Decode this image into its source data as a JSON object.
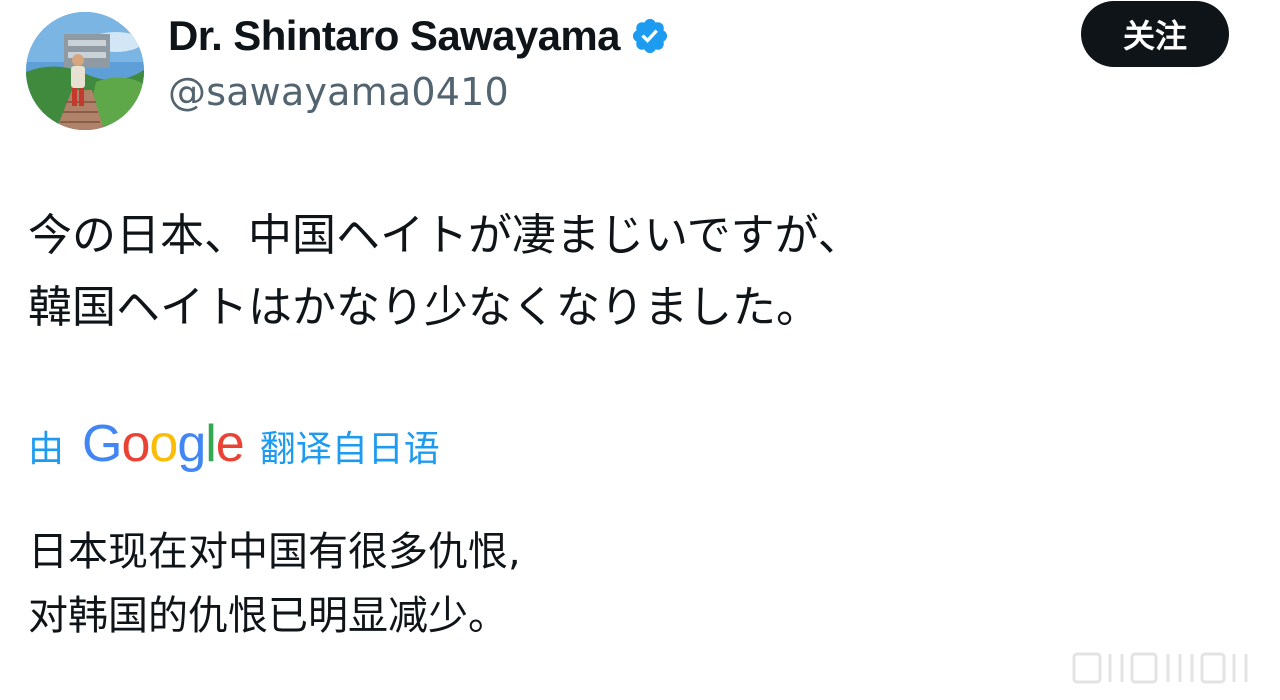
{
  "profile": {
    "display_name": "Dr. Shintaro Sawayama",
    "handle": "@sawayama0410",
    "verified_icon": "verified-badge-icon",
    "avatar_icon": "profile-avatar"
  },
  "follow_button": {
    "label": "关注"
  },
  "tweet": {
    "lines": [
      "今の日本、中国ヘイトが凄まじいですが、",
      "韓国ヘイトはかなり少なくなりました。"
    ]
  },
  "translation": {
    "prefix": "由",
    "brand": "Google",
    "suffix": "翻译自日语",
    "brand_colors": [
      "#4285f4",
      "#ea4335",
      "#fbbc05",
      "#4285f4",
      "#34a853",
      "#ea4335"
    ],
    "lines": [
      "日本现在对中国有很多仇恨,",
      "对韩国的仇恨已明显减少。"
    ]
  },
  "colors": {
    "accent": "#1d9bf0",
    "text": "#0f1419",
    "secondary_text": "#536471",
    "button_bg": "#0f1419",
    "button_text": "#ffffff"
  }
}
